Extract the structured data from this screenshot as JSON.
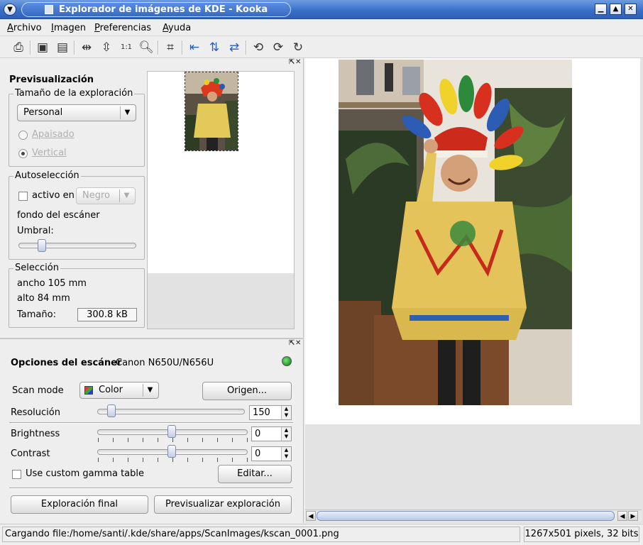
{
  "window": {
    "title": "Explorador de imágenes de KDE - Kooka",
    "menu_button_icon": "chevron-down-icon",
    "controls": [
      "minimize-icon",
      "maximize-icon",
      "close-icon"
    ]
  },
  "menubar": {
    "items": [
      {
        "label": "Archivo"
      },
      {
        "label": "Imagen"
      },
      {
        "label": "Preferencias"
      },
      {
        "label": "Ayuda"
      }
    ]
  },
  "toolbar": {
    "icons": [
      "print-icon",
      "load-to-gallery-icon",
      "save-to-gallery-icon",
      "fit-width-icon",
      "fit-height-icon",
      "original-size-icon",
      "zoom-icon",
      "crop-icon",
      "mirror-vertical-icon",
      "mirror-horizontal-icon",
      "mirror-both-icon",
      "rotate-left-icon",
      "rotate-right-icon",
      "rotate-180-icon"
    ]
  },
  "preview": {
    "heading": "Previsualización",
    "scan_size": {
      "group_title": "Tamaño de la exploración",
      "selected": "Personal",
      "landscape_label": "Apaisado",
      "portrait_label": "Vertical",
      "landscape_checked": false,
      "portrait_checked": true
    },
    "autoselect": {
      "group_title": "Autoselección",
      "active_label": "activo en",
      "background_value": "Negro",
      "background_label": "fondo del escáner",
      "threshold_label": "Umbral:"
    },
    "selection": {
      "group_title": "Selección",
      "width": "ancho 105 mm",
      "height": "alto 84 mm",
      "size_label": "Tamaño:",
      "size_value": "300.8 kB"
    }
  },
  "scanner": {
    "title_bold": "Opciones del escáner",
    "device": "Canon N650U/N656U",
    "status_color": "#2fa52f",
    "scan_mode_label": "Scan mode",
    "scan_mode_value": "Color",
    "source_button": "Origen...",
    "resolution_label": "Resolución",
    "resolution_value": "150",
    "brightness_label": "Brightness",
    "brightness_value": "0",
    "contrast_label": "Contrast",
    "contrast_value": "0",
    "gamma_label": "Use custom gamma table",
    "gamma_checked": false,
    "edit_button": "Editar...",
    "final_scan_button": "Exploración final",
    "preview_scan_button": "Previsualizar exploración"
  },
  "status": {
    "message": "Cargando file:/home/santi/.kde/share/apps/ScanImages/kscan_0001.png",
    "image_info": "1267x501 pixels, 32 bits"
  }
}
